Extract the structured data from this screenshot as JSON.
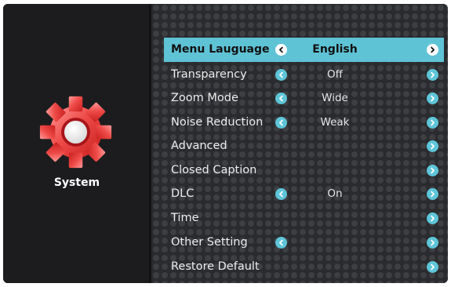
{
  "sidebar": {
    "label": "System",
    "icon": "gear-icon"
  },
  "colors": {
    "accent": "#5fc3d6",
    "gear": "#e8403d",
    "panel": "#2a2b2e"
  },
  "menu": [
    {
      "label": "Menu Lauguage",
      "value": "English",
      "left_arrow": true,
      "right_arrow": true,
      "selected": true
    },
    {
      "label": "Transparency",
      "value": "Off",
      "left_arrow": true,
      "right_arrow": true
    },
    {
      "label": "Zoom Mode",
      "value": "Wide",
      "left_arrow": true,
      "right_arrow": true
    },
    {
      "label": "Noise Reduction",
      "value": "Weak",
      "left_arrow": true,
      "right_arrow": true
    },
    {
      "label": "Advanced",
      "value": "",
      "left_arrow": false,
      "right_arrow": true
    },
    {
      "label": "Closed Caption",
      "value": "",
      "left_arrow": false,
      "right_arrow": true
    },
    {
      "label": "DLC",
      "value": "On",
      "left_arrow": true,
      "right_arrow": true
    },
    {
      "label": "Time",
      "value": "",
      "left_arrow": false,
      "right_arrow": true
    },
    {
      "label": "Other Setting",
      "value": "",
      "left_arrow": true,
      "right_arrow": true
    },
    {
      "label": "Restore Default",
      "value": "",
      "left_arrow": false,
      "right_arrow": true
    }
  ]
}
